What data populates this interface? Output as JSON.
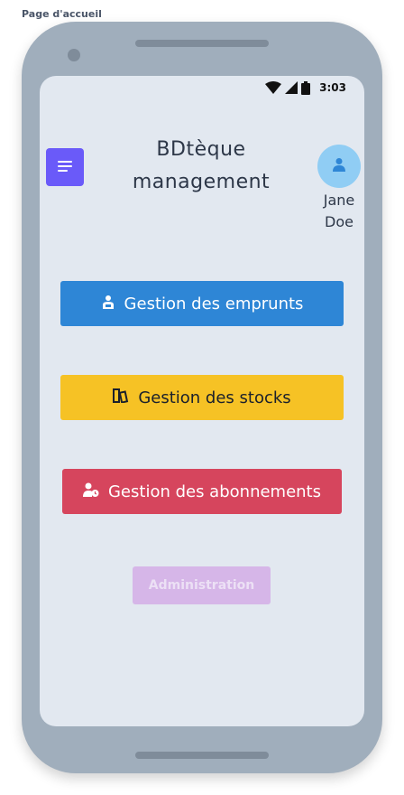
{
  "page": {
    "caption": "Page d'accueil"
  },
  "status_bar": {
    "time": "3:03",
    "icons": [
      "wifi-icon",
      "signal-icon",
      "battery-icon"
    ]
  },
  "header": {
    "title_line1": "BDtèque",
    "title_line2": "management",
    "menu_icon": "menu-icon",
    "user": {
      "first_name": "Jane",
      "last_name": "Doe",
      "avatar_icon": "user-icon"
    }
  },
  "actions": [
    {
      "label": "Gestion des emprunts",
      "icon": "reader-icon",
      "color": "#2e86d6"
    },
    {
      "label": "Gestion des stocks",
      "icon": "books-icon",
      "color": "#f6c225"
    },
    {
      "label": "Gestion des abonnements",
      "icon": "user-clock-icon",
      "color": "#d6455d"
    },
    {
      "label": "Administration",
      "color": "#d6b6e8",
      "disabled": true
    }
  ],
  "colors": {
    "phone_frame": "#a0aebc",
    "screen": "#e2e8f0",
    "menu_button": "#6a5af9",
    "avatar": "#90cdf4"
  }
}
